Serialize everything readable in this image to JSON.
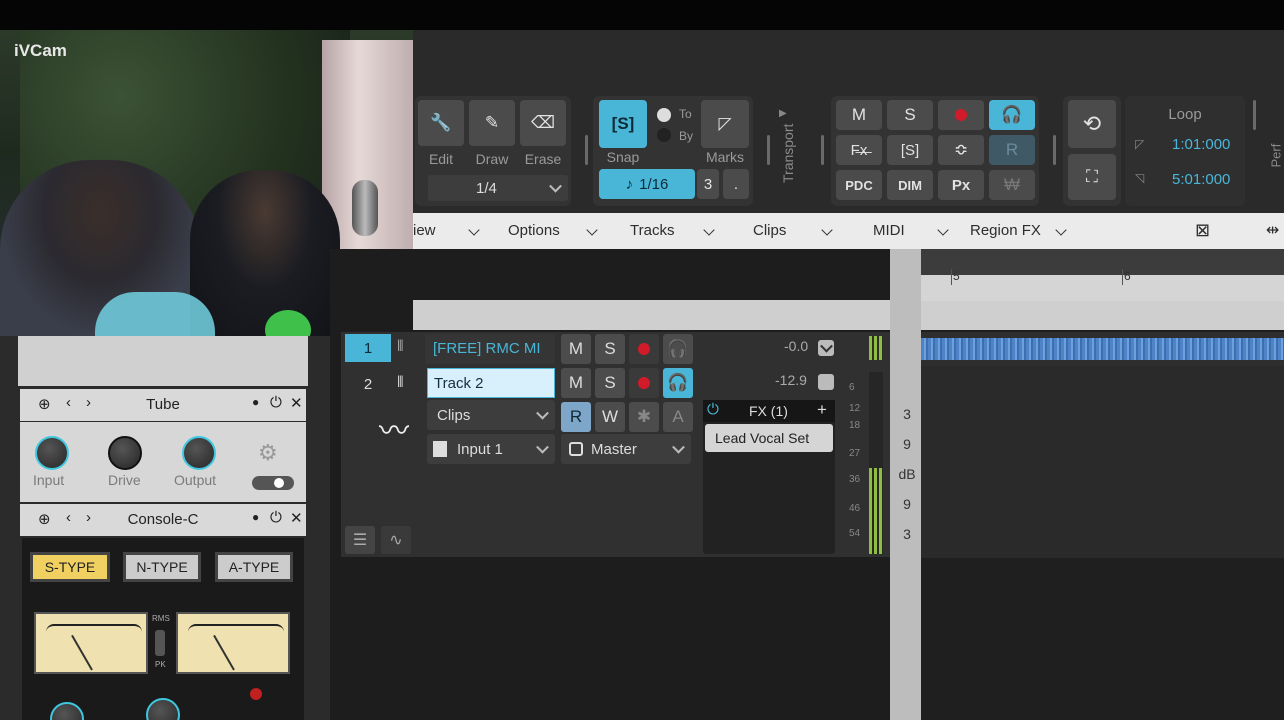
{
  "webcam": {
    "label": "iVCam"
  },
  "toolbar": {
    "tools": [
      {
        "label": "Edit",
        "icon": "wrench-icon"
      },
      {
        "label": "Draw",
        "icon": "pencil-icon"
      },
      {
        "label": "Erase",
        "icon": "eraser-icon"
      }
    ],
    "quantize": "1/4",
    "snap": {
      "label": "Snap",
      "to": "To",
      "by": "By",
      "value": "1/16",
      "triplet": "3",
      "dot": "."
    },
    "marks_label": "Marks",
    "transport_label": "Transport",
    "mix_buttons": [
      "M",
      "S",
      "R"
    ],
    "pdc": "PDC",
    "dim": "DIM",
    "px": "Px",
    "solo_bracket": "[S]",
    "loop": {
      "label": "Loop",
      "start": "1:01:000",
      "end": "5:01:000"
    },
    "perf_label": "Perf"
  },
  "menubar": {
    "items": [
      "iew",
      "Options",
      "Tracks",
      "Clips",
      "MIDI",
      "Region FX"
    ]
  },
  "plugins": [
    {
      "name": "Tube",
      "knobs": [
        "Input",
        "Drive",
        "Output"
      ]
    },
    {
      "name": "Console-C",
      "types": [
        "S-TYPE",
        "N-TYPE",
        "A-TYPE"
      ],
      "meter_labels": [
        "RMS",
        "PK"
      ]
    }
  ],
  "tracks": [
    {
      "number": "1",
      "name": "[FREE] RMC MI",
      "volume": "-0.0",
      "buttons": [
        "M",
        "S"
      ]
    },
    {
      "number": "2",
      "name": "Track 2",
      "volume": "-12.9",
      "buttons": [
        "M",
        "S"
      ],
      "automation": [
        "R",
        "W",
        "✱",
        "A"
      ],
      "clips_label": "Clips",
      "input": "Input 1",
      "output": "Master",
      "fx": {
        "label": "FX (1)",
        "preset": "Lead Vocal Set"
      }
    }
  ],
  "meter_scale": [
    "6",
    "12",
    "18",
    "27",
    "36",
    "46",
    "54"
  ],
  "db_scale": [
    "3",
    "9",
    "dB",
    "9",
    "3"
  ],
  "ruler": {
    "marks": [
      "5",
      "6"
    ]
  },
  "colors": {
    "accent": "#49b6d8",
    "record": "#d11a2a",
    "waveform": "#4d84c8"
  }
}
